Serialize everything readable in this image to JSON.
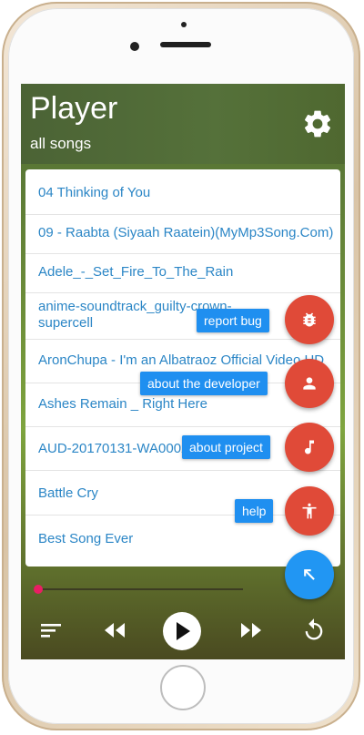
{
  "appbar": {
    "title": "Player",
    "subtitle": "all songs"
  },
  "songs": [
    "04 Thinking of You",
    "09 - Raabta (Siyaah Raatein)(MyMp3Song.Com)",
    "Adele_-_Set_Fire_To_The_Rain",
    "anime-soundtrack_guilty-crown-...",
    "supercell",
    "AronChupa - I'm an Albatraoz Official Video HD",
    "Ashes Remain _ Right Here",
    "AUD-20170131-WA0002",
    "Battle Cry",
    "Best Song Ever"
  ],
  "fab_menu": {
    "report_bug": "report bug",
    "about_developer": "about the developer",
    "about_project": "about project",
    "help": "help"
  },
  "player": {
    "progress": 0.0
  },
  "colors": {
    "accent_red": "#e04a38",
    "accent_blue": "#2196f3",
    "link_blue": "#2b86c6",
    "appbar_green": "#4f6b33"
  },
  "icons": {
    "settings": "gear-icon",
    "report_bug": "bug-icon",
    "about_developer": "person-icon",
    "about_project": "music-note-icon",
    "help": "accessibility-icon",
    "fab_main": "arrow-up-left-icon",
    "queue": "queue-icon",
    "previous": "rewind-icon",
    "play": "play-icon",
    "next": "fast-forward-icon",
    "repeat": "repeat-icon"
  }
}
